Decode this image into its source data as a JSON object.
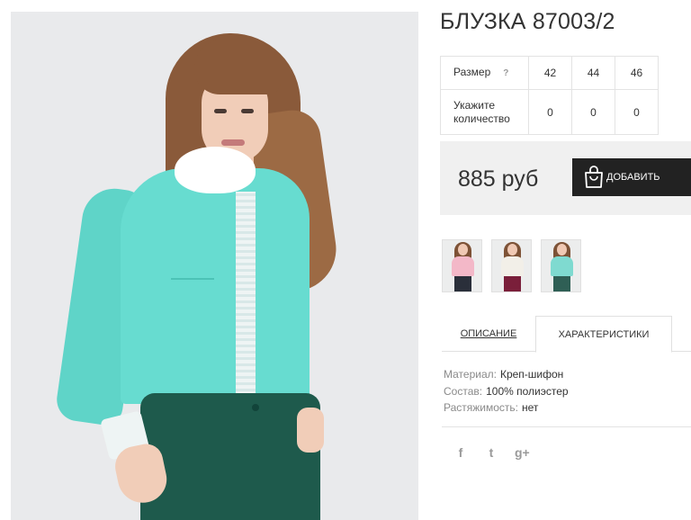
{
  "product": {
    "title": "БЛУЗКА 87003/2",
    "size_table": {
      "size_label": "Размер",
      "help_glyph": "?",
      "sizes": [
        "42",
        "44",
        "46"
      ],
      "qty_label": "Укажите количество",
      "quantities": [
        "0",
        "0",
        "0"
      ]
    },
    "price": "885 руб",
    "add_button_label": "ДОБАВИТЬ"
  },
  "color_variants": [
    {
      "top_color": "#f3b8c8",
      "pants_color": "#2a2f3a"
    },
    {
      "top_color": "#f2efe8",
      "pants_color": "#7a1f3a"
    },
    {
      "top_color": "#7fdad0",
      "pants_color": "#2f5f55"
    }
  ],
  "tabs": {
    "description": "ОПИСАНИЕ",
    "specifications": "ХАРАКТЕРИСТИКИ"
  },
  "specs": [
    {
      "key": "Материал:",
      "value": "Креп-шифон"
    },
    {
      "key": "Состав:",
      "value": "100% полиэстер"
    },
    {
      "key": "Растяжимость:",
      "value": "нет"
    }
  ],
  "social": {
    "facebook": "f",
    "twitter": "t",
    "googleplus": "g+"
  },
  "icons": {
    "bag": "shopping-bag-icon",
    "help": "help-icon"
  }
}
